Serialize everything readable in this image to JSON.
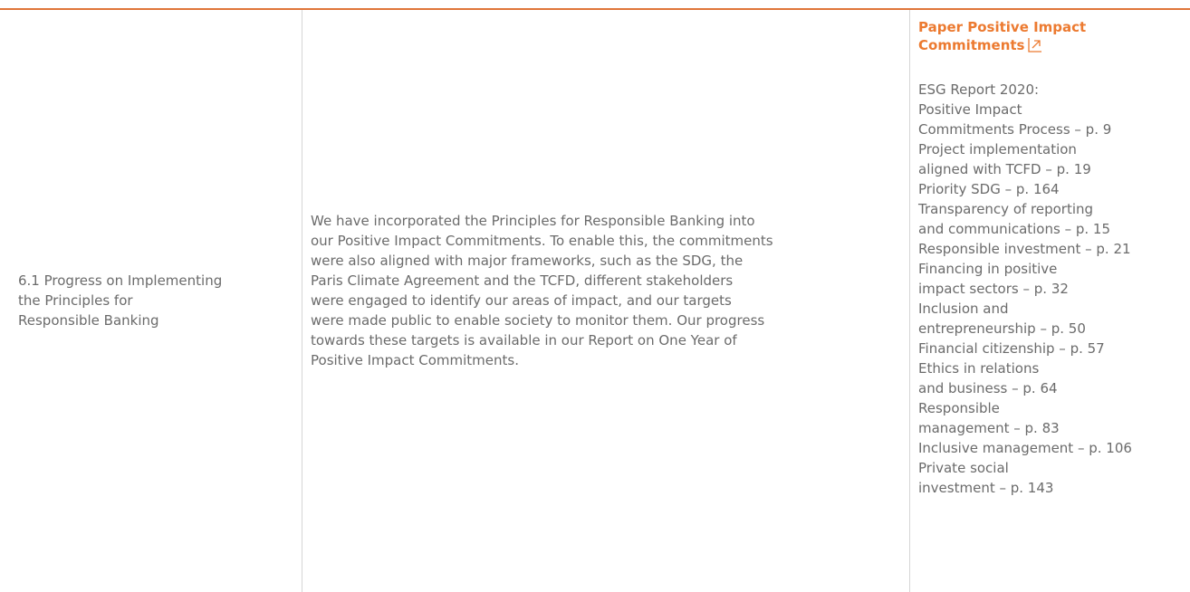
{
  "row": {
    "topic_lines": [
      "6.1 Progress on Implementing",
      "the Principles for",
      "Responsible Banking"
    ],
    "description_lines": [
      "We have incorporated the Principles for Responsible Banking into",
      "our Positive Impact Commitments. To enable this, the commitments",
      "were also aligned with major frameworks, such as the SDG, the",
      "Paris Climate Agreement and the TCFD, different stakeholders",
      "were engaged to identify our areas of impact, and our targets",
      "were made public to enable society to monitor them. Our progress",
      "towards these targets is available in our Report on One Year of",
      "Positive Impact Commitments."
    ],
    "reference_link": {
      "lines": [
        "Paper Positive Impact",
        "Commitments"
      ],
      "icon": "external-link-icon"
    },
    "reference_lines": [
      "ESG Report 2020:",
      "Positive Impact",
      "Commitments Process – p. 9",
      "Project implementation",
      "aligned with TCFD – p. 19",
      "Priority SDG – p. 164",
      "Transparency of reporting",
      "and communications – p.  15",
      "Responsible investment – p. 21",
      "Financing in positive",
      "impact sectors – p. 32",
      "Inclusion and",
      "entrepreneurship – p. 50",
      "Financial citizenship – p. 57",
      "Ethics in relations",
      "and business – p. 64",
      "Responsible",
      "management – p. 83",
      "Inclusive management – p. 106",
      "Private social",
      "investment – p. 143"
    ]
  },
  "colors": {
    "accent": "#ec7a30",
    "rule": "#e0763a",
    "text": "#6b6b6b",
    "divider": "#d6d6d6"
  }
}
